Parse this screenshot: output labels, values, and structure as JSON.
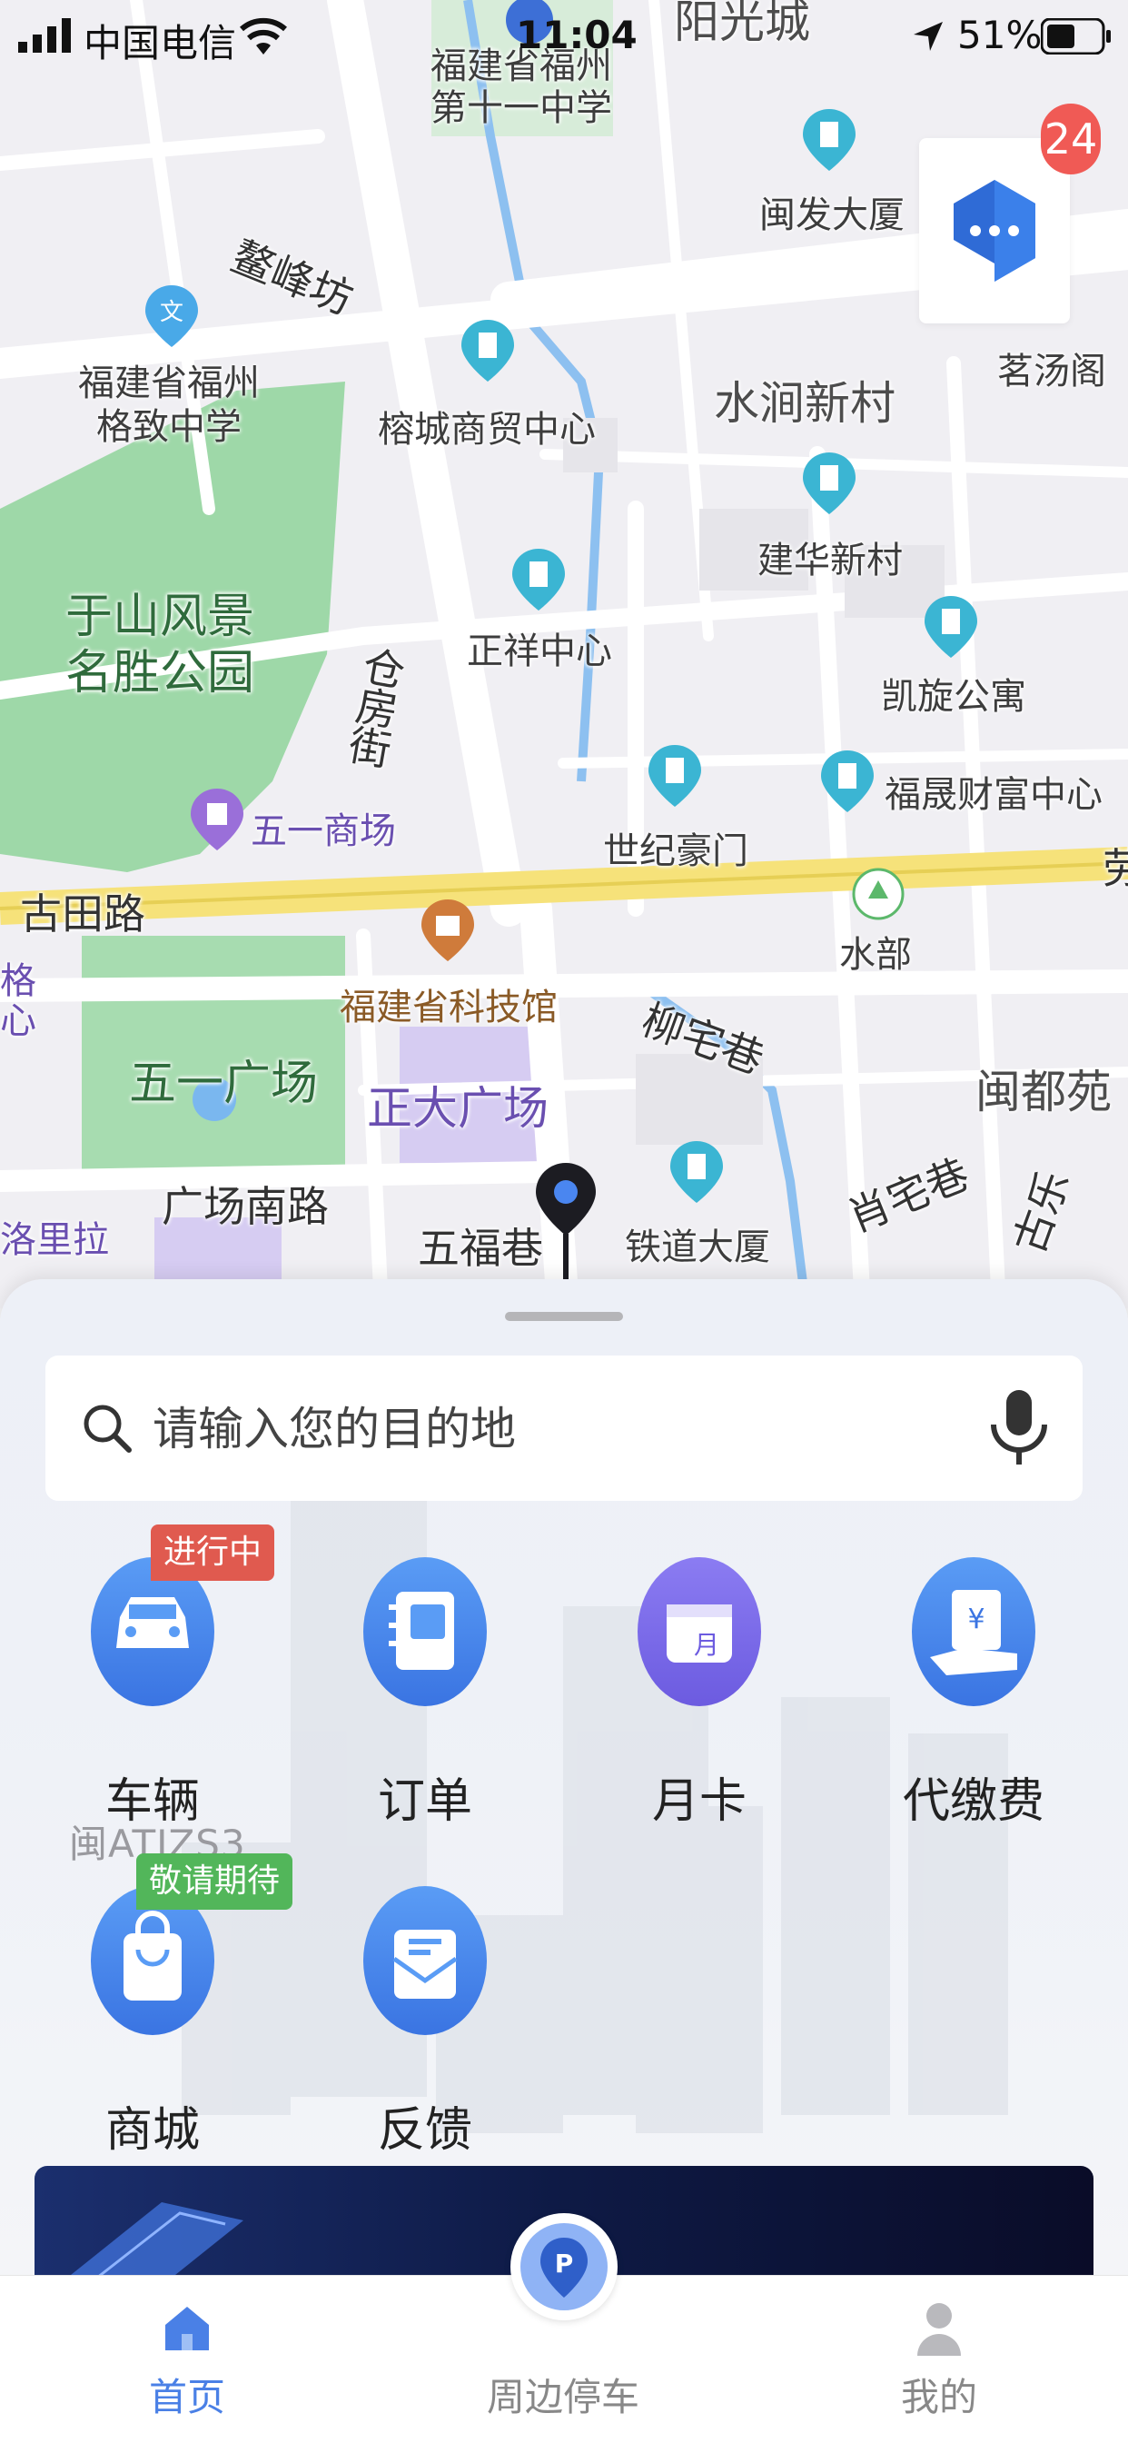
{
  "status_bar": {
    "carrier": "中国电信",
    "time": "11:04",
    "battery": "51%"
  },
  "map": {
    "labels": {
      "yangguangcheng": "阳光城",
      "fuzhou11": "福建省福州\n第十一中学",
      "minfa": "闽发大厦",
      "aofengfang": "鳌峰坊",
      "gezhi": "福建省福州\n格致中学",
      "rongcheng": "榕城商贸中心",
      "shuijian": "水涧新村",
      "mingtang": "茗汤阁",
      "jianhua": "建华新村",
      "yushan": "于山风景\n名胜公园",
      "zhengxiang": "正祥中心",
      "cangfang": "仓\n房\n街",
      "kaixuan": "凯旋公寓",
      "wuyimall": "五一商场",
      "shiji": "世纪豪门",
      "fusheng": "福晟财富中心",
      "gutian": "古田路",
      "shuibu": "水部",
      "kejiguan": "福建省科技馆",
      "liuzhai": "柳宅巷",
      "mindu": "闽都苑",
      "wuyiplaza": "五一广场",
      "zhengda": "正大广场",
      "gecx": "格\n心",
      "guangchangnan": "广场南路",
      "wufu": "五福巷",
      "tiedao": "铁道大厦",
      "xiaozhai": "肖宅巷",
      "guan": "古乐",
      "lao": "劳",
      "luoli": "洛里拉"
    },
    "chat_badge_count": "24",
    "accent": "#4a80e6"
  },
  "search": {
    "placeholder": "请输入您的目的地"
  },
  "quick_actions": [
    {
      "label": "车辆",
      "icon": "car-icon",
      "tag": "进行中",
      "tag_color": "#e05a4f"
    },
    {
      "label": "订单",
      "icon": "order-notebook-icon"
    },
    {
      "label": "月卡",
      "icon": "monthly-card-icon",
      "icon_text": "月"
    },
    {
      "label": "代缴费",
      "icon": "pay-on-behalf-icon",
      "icon_text": "¥"
    },
    {
      "label": "商城",
      "icon": "shopping-bag-icon",
      "tag": "敬请期待",
      "tag_color": "#52b65a"
    },
    {
      "label": "反馈",
      "icon": "feedback-mail-icon"
    }
  ],
  "vehicle_plate": "闽ATJZS3",
  "tabbar": {
    "items": [
      {
        "label": "首页",
        "icon": "home-icon",
        "active": true
      },
      {
        "label": "周边停车",
        "icon": "parking-icon",
        "active": false
      },
      {
        "label": "我的",
        "icon": "profile-icon",
        "active": false
      }
    ]
  }
}
